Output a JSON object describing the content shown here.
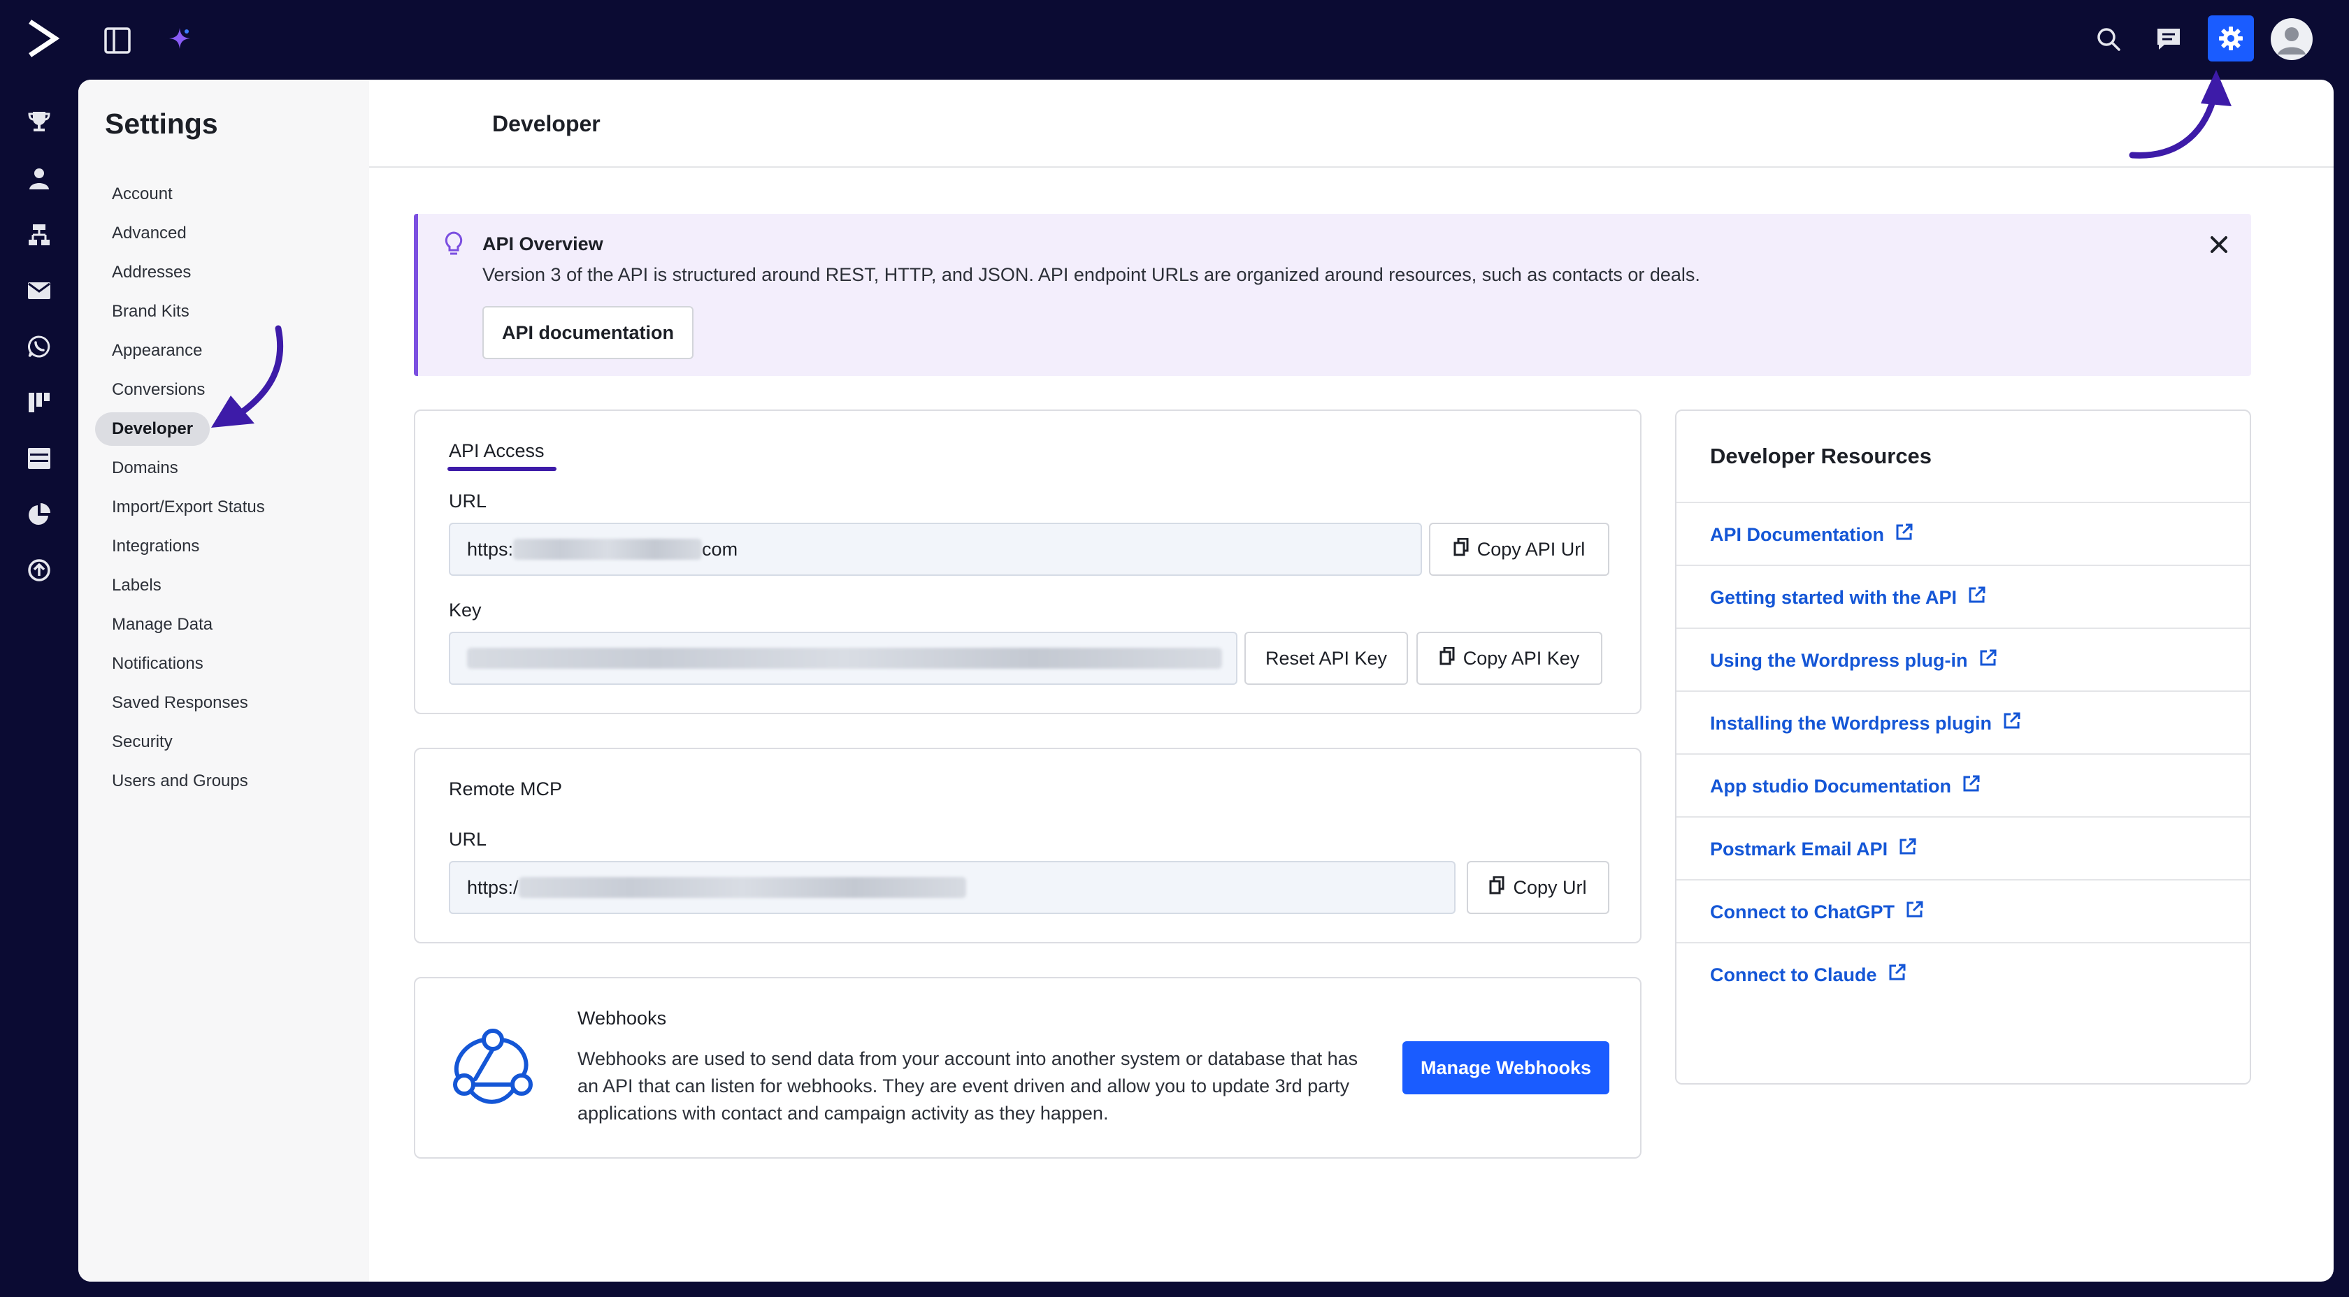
{
  "topbar": {
    "icons": [
      "logo-icon",
      "panel-toggle-icon",
      "ai-sparkle-icon",
      "search-icon",
      "chat-icon",
      "gear-icon",
      "user-avatar-icon"
    ]
  },
  "rail": {
    "icons": [
      "trophy-icon",
      "contacts-icon",
      "automations-icon",
      "email-icon",
      "whatsapp-icon",
      "pipeline-icon",
      "pages-icon",
      "reports-icon",
      "upgrade-icon"
    ]
  },
  "sidebar": {
    "title": "Settings",
    "items": [
      {
        "label": "Account",
        "active": false
      },
      {
        "label": "Advanced",
        "active": false
      },
      {
        "label": "Addresses",
        "active": false
      },
      {
        "label": "Brand Kits",
        "active": false
      },
      {
        "label": "Appearance",
        "active": false
      },
      {
        "label": "Conversions",
        "active": false
      },
      {
        "label": "Developer",
        "active": true
      },
      {
        "label": "Domains",
        "active": false
      },
      {
        "label": "Import/Export Status",
        "active": false
      },
      {
        "label": "Integrations",
        "active": false
      },
      {
        "label": "Labels",
        "active": false
      },
      {
        "label": "Manage Data",
        "active": false
      },
      {
        "label": "Notifications",
        "active": false
      },
      {
        "label": "Saved Responses",
        "active": false
      },
      {
        "label": "Security",
        "active": false
      },
      {
        "label": "Users and Groups",
        "active": false
      }
    ]
  },
  "header": {
    "title": "Developer"
  },
  "banner": {
    "title": "API Overview",
    "text": "Version 3 of the API is structured around REST, HTTP, and JSON. API endpoint URLs are organized around resources, such as contacts or deals.",
    "button": "API documentation"
  },
  "api_access": {
    "title": "API Access",
    "url_label": "URL",
    "url_prefix": "https:",
    "url_suffix": "com",
    "copy_url_button": "Copy API Url",
    "key_label": "Key",
    "reset_key_button": "Reset API Key",
    "copy_key_button": "Copy API Key"
  },
  "remote_mcp": {
    "title": "Remote MCP",
    "url_label": "URL",
    "url_prefix": "https:/",
    "copy_button": "Copy Url"
  },
  "webhooks": {
    "title": "Webhooks",
    "description": "Webhooks are used to send data from your account into another system or database that has an API that can listen for webhooks. They are event driven and allow you to update 3rd party applications with contact and campaign activity as they happen.",
    "button": "Manage Webhooks"
  },
  "resources": {
    "title": "Developer Resources",
    "links": [
      "API Documentation",
      "Getting started with the API",
      "Using the Wordpress plug-in",
      "Installing the Wordpress plugin",
      "App studio Documentation",
      "Postmark Email API",
      "Connect to ChatGPT",
      "Connect to Claude"
    ]
  },
  "colors": {
    "background": "#0b0b33",
    "accent": "#1a5cff",
    "link": "#1456d6",
    "banner_bg": "#f3eefc",
    "banner_border": "#7b4fe0",
    "annotation": "#3d1ba8"
  }
}
